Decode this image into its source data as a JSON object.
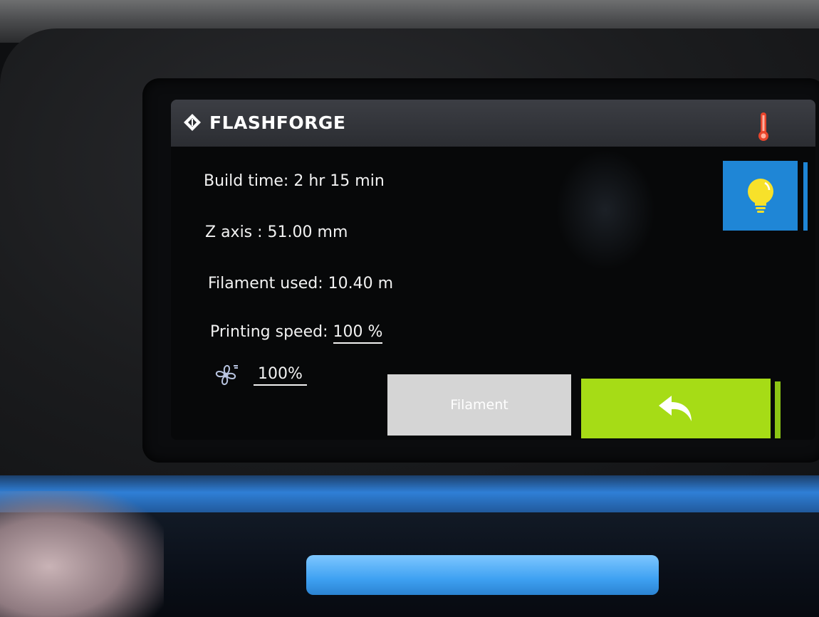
{
  "header": {
    "brand": "FLASHFORGE",
    "icons": {
      "logo": "flashforge-logo-icon",
      "temperature": "thermometer-icon"
    }
  },
  "status": {
    "build_time": "Build time: 2 hr 15 min",
    "z_axis": "Z axis : 51.00 mm",
    "filament_used": "Filament used: 10.40 m",
    "printing_speed_label": "Printing speed: ",
    "printing_speed_value": "100 %",
    "fan_speed": "100%"
  },
  "controls": {
    "light_icon": "lightbulb-icon",
    "filament_label": "Filament",
    "back_icon": "back-arrow-icon"
  },
  "colors": {
    "titlebar": "#2f3136",
    "light_button": "#1f86d6",
    "filament_button": "#d5d5d5",
    "back_button": "#a6dc16",
    "thermometer": "#e8452c",
    "bulb": "#f7e12a"
  }
}
